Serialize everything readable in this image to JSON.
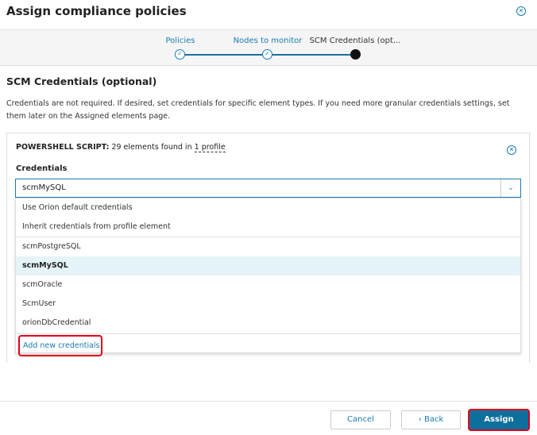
{
  "dialog": {
    "title": "Assign compliance policies",
    "close_icon": "close-circle-icon"
  },
  "stepper": {
    "steps": [
      {
        "label": "Policies",
        "state": "complete"
      },
      {
        "label": "Nodes to monitor",
        "state": "complete"
      },
      {
        "label": "SCM Credentials (opt...",
        "state": "current"
      }
    ]
  },
  "section": {
    "title": "SCM Credentials (optional)",
    "description": "Credentials are not required. If desired, set credentials for specific element types. If you need more granular credentials settings, set them later on the Assigned elements page."
  },
  "card": {
    "type_label": "POWERSHELL SCRIPT:",
    "found_text": "29 elements found in",
    "profile_link": "1 profile",
    "credentials_label": "Credentials",
    "selected_value": "scmMySQL",
    "options": [
      "Use Orion default credentials",
      "Inherit credentials from profile element",
      "scmPostgreSQL",
      "scmMySQL",
      "scmOracle",
      "ScmUser",
      "orionDbCredential"
    ],
    "add_new": "Add new credentials"
  },
  "footer": {
    "cancel": "Cancel",
    "back": "Back",
    "assign": "Assign"
  },
  "colors": {
    "accent": "#1a7bb0",
    "primary_button": "#0d6f9c",
    "highlight": "#e0001b",
    "selected_row": "#e5f4f8"
  }
}
